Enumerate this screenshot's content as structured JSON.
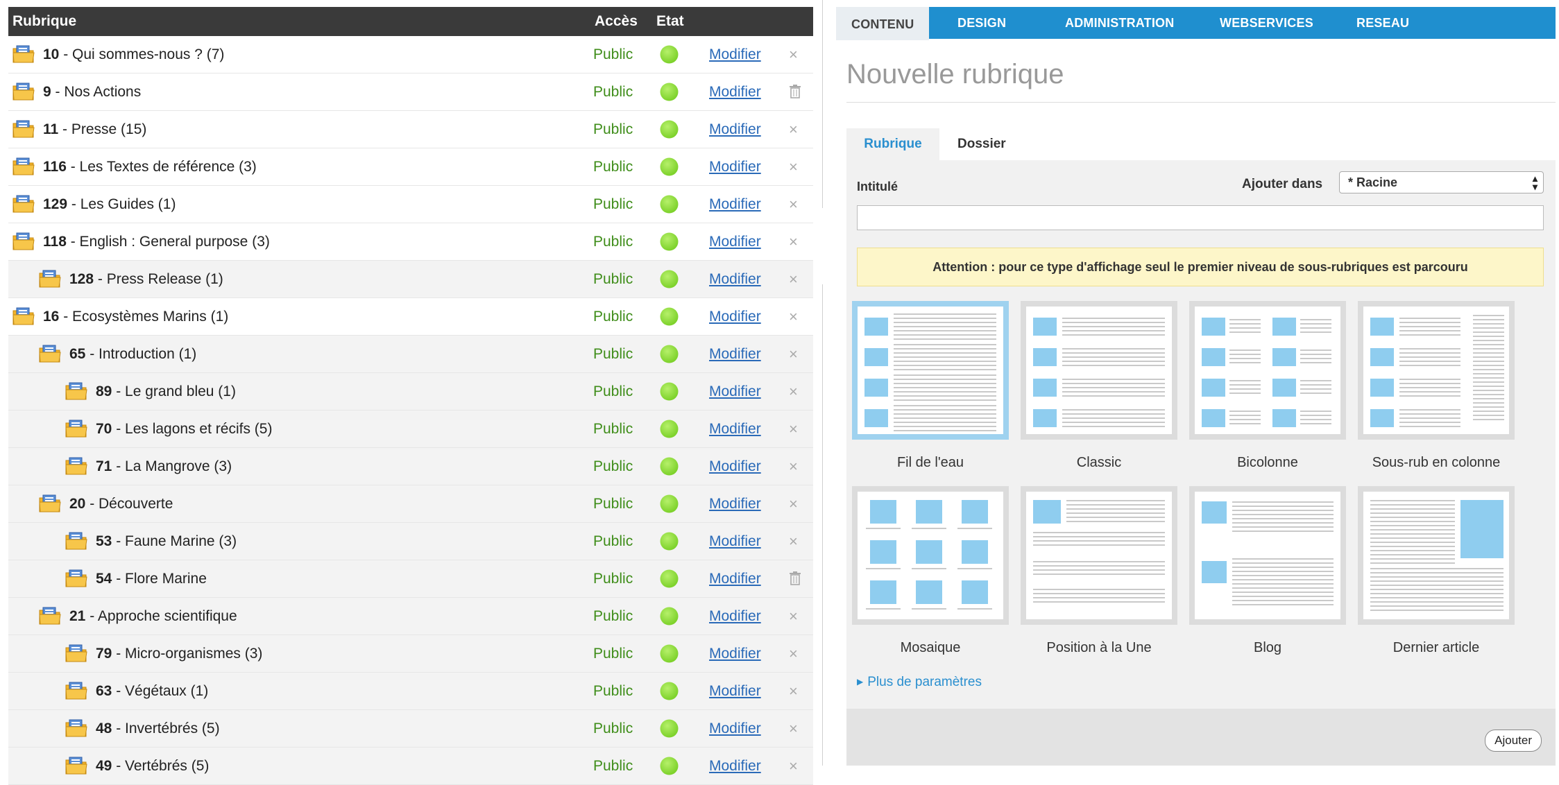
{
  "list": {
    "header": {
      "rubrique": "Rubrique",
      "acces": "Accès",
      "etat": "Etat"
    },
    "rows": [
      {
        "id": "10",
        "name": " - Qui sommes-nous ? (7)",
        "level": 0,
        "acces": "Public",
        "modifier": "Modifier",
        "action": "delete"
      },
      {
        "id": "9",
        "name": " - Nos Actions",
        "level": 0,
        "acces": "Public",
        "modifier": "Modifier",
        "action": "trash"
      },
      {
        "id": "11",
        "name": " - Presse (15)",
        "level": 0,
        "acces": "Public",
        "modifier": "Modifier",
        "action": "delete"
      },
      {
        "id": "116",
        "name": " - Les Textes de référence (3)",
        "level": 0,
        "acces": "Public",
        "modifier": "Modifier",
        "action": "delete"
      },
      {
        "id": "129",
        "name": " - Les Guides (1)",
        "level": 0,
        "acces": "Public",
        "modifier": "Modifier",
        "action": "delete"
      },
      {
        "id": "118",
        "name": " - English : General purpose (3)",
        "level": 0,
        "acces": "Public",
        "modifier": "Modifier",
        "action": "delete"
      },
      {
        "id": "128",
        "name": " - Press Release (1)",
        "level": 1,
        "acces": "Public",
        "modifier": "Modifier",
        "action": "delete"
      },
      {
        "id": "16",
        "name": " - Ecosystèmes Marins (1)",
        "level": 0,
        "acces": "Public",
        "modifier": "Modifier",
        "action": "delete"
      },
      {
        "id": "65",
        "name": " - Introduction (1)",
        "level": 1,
        "acces": "Public",
        "modifier": "Modifier",
        "action": "delete"
      },
      {
        "id": "89",
        "name": " - Le grand bleu (1)",
        "level": 2,
        "acces": "Public",
        "modifier": "Modifier",
        "action": "delete"
      },
      {
        "id": "70",
        "name": " - Les lagons et récifs (5)",
        "level": 2,
        "acces": "Public",
        "modifier": "Modifier",
        "action": "delete"
      },
      {
        "id": "71",
        "name": " - La Mangrove (3)",
        "level": 2,
        "acces": "Public",
        "modifier": "Modifier",
        "action": "delete"
      },
      {
        "id": "20",
        "name": " - Découverte",
        "level": 1,
        "acces": "Public",
        "modifier": "Modifier",
        "action": "delete"
      },
      {
        "id": "53",
        "name": " - Faune Marine (3)",
        "level": 2,
        "acces": "Public",
        "modifier": "Modifier",
        "action": "delete"
      },
      {
        "id": "54",
        "name": " - Flore Marine",
        "level": 2,
        "acces": "Public",
        "modifier": "Modifier",
        "action": "trash"
      },
      {
        "id": "21",
        "name": " - Approche scientifique",
        "level": 1,
        "acces": "Public",
        "modifier": "Modifier",
        "action": "delete"
      },
      {
        "id": "79",
        "name": " - Micro-organismes (3)",
        "level": 2,
        "acces": "Public",
        "modifier": "Modifier",
        "action": "delete"
      },
      {
        "id": "63",
        "name": " - Végétaux (1)",
        "level": 2,
        "acces": "Public",
        "modifier": "Modifier",
        "action": "delete"
      },
      {
        "id": "48",
        "name": " - Invertébrés (5)",
        "level": 2,
        "acces": "Public",
        "modifier": "Modifier",
        "action": "delete"
      },
      {
        "id": "49",
        "name": " - Vertébrés (5)",
        "level": 2,
        "acces": "Public",
        "modifier": "Modifier",
        "action": "delete"
      }
    ],
    "delete_glyph": "×",
    "status_color": "#7cd12a",
    "access_color": "#3f8d1a",
    "link_color": "#2a6ab8"
  },
  "nav": {
    "tabs": [
      "CONTENU",
      "DESIGN",
      "ADMINISTRATION",
      "WEBSERVICES",
      "RESEAU"
    ],
    "active": "CONTENU",
    "color": "#1f8fcf"
  },
  "form": {
    "page_title": "Nouvelle rubrique",
    "subtabs": {
      "active": "Rubrique",
      "inactive": "Dossier"
    },
    "intitule_label": "Intitulé",
    "intitule_value": "",
    "ajouter_dans_label": "Ajouter dans",
    "ajouter_dans_value": "* Racine",
    "warning": "Attention : pour ce type d'affichage seul le premier niveau de sous-rubriques est parcouru",
    "templates": [
      {
        "label": "Fil de l'eau",
        "selected": true
      },
      {
        "label": "Classic",
        "selected": false
      },
      {
        "label": "Bicolonne",
        "selected": false
      },
      {
        "label": "Sous-rub en colonne",
        "selected": false
      },
      {
        "label": "Mosaique",
        "selected": false
      },
      {
        "label": "Position à la Une",
        "selected": false
      },
      {
        "label": "Blog",
        "selected": false
      },
      {
        "label": "Dernier article",
        "selected": false
      }
    ],
    "more_params": "Plus de paramètres",
    "submit": "Ajouter",
    "accent_color": "#2a8fcf",
    "thumb_blue": "#8fcdef"
  }
}
